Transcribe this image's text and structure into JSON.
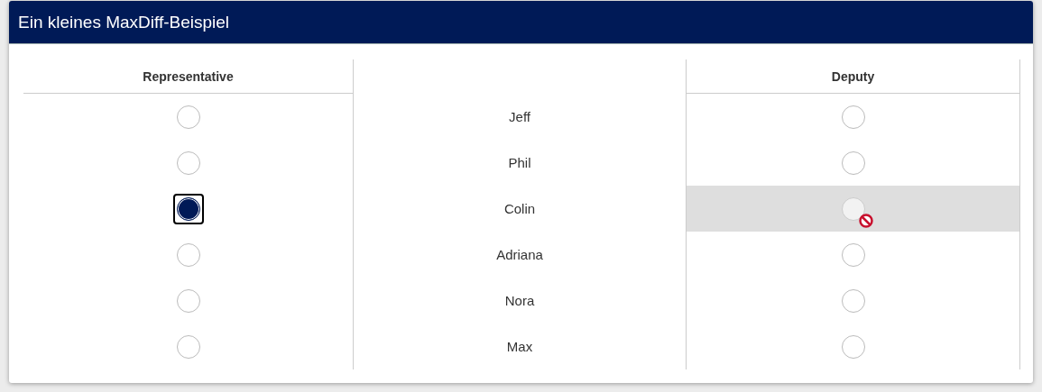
{
  "title": "Ein kleines MaxDiff-Beispiel",
  "columns": {
    "best": "Representative",
    "worst": "Deputy"
  },
  "rows": [
    {
      "name": "Jeff",
      "best_selected": false,
      "worst_selected": false,
      "worst_disabled": false
    },
    {
      "name": "Phil",
      "best_selected": false,
      "worst_selected": false,
      "worst_disabled": false
    },
    {
      "name": "Colin",
      "best_selected": true,
      "worst_selected": false,
      "worst_disabled": true
    },
    {
      "name": "Adriana",
      "best_selected": false,
      "worst_selected": false,
      "worst_disabled": false
    },
    {
      "name": "Nora",
      "best_selected": false,
      "worst_selected": false,
      "worst_disabled": false
    },
    {
      "name": "Max",
      "best_selected": false,
      "worst_selected": false,
      "worst_disabled": false
    }
  ]
}
